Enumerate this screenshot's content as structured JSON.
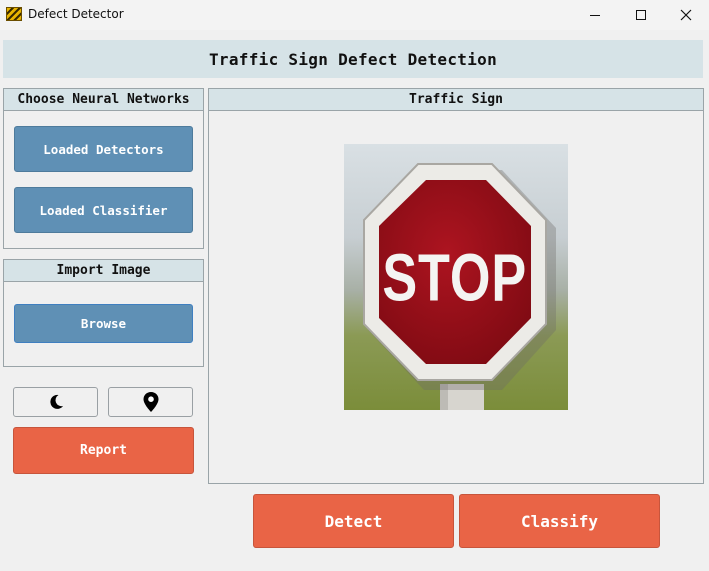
{
  "window": {
    "title": "Defect Detector",
    "controls": [
      "minimize",
      "maximize",
      "close"
    ]
  },
  "header": {
    "title": "Traffic Sign Defect Detection"
  },
  "networks_panel": {
    "title": "Choose Neural Networks",
    "detectors_label": "Loaded Detectors",
    "classifier_label": "Loaded Classifier"
  },
  "import_panel": {
    "title": "Import Image",
    "browse_label": "Browse"
  },
  "icon_buttons": {
    "theme_icon": "moon-icon",
    "location_icon": "map-pin-icon"
  },
  "report_label": "Report",
  "sign_panel": {
    "title": "Traffic Sign",
    "sign_text": "STOP"
  },
  "actions": {
    "detect_label": "Detect",
    "classify_label": "Classify"
  },
  "colors": {
    "blue_button": "#5f90b5",
    "red_button": "#e96446",
    "panel_header": "#d6e3e7",
    "stop_red": "#9e0d16"
  }
}
